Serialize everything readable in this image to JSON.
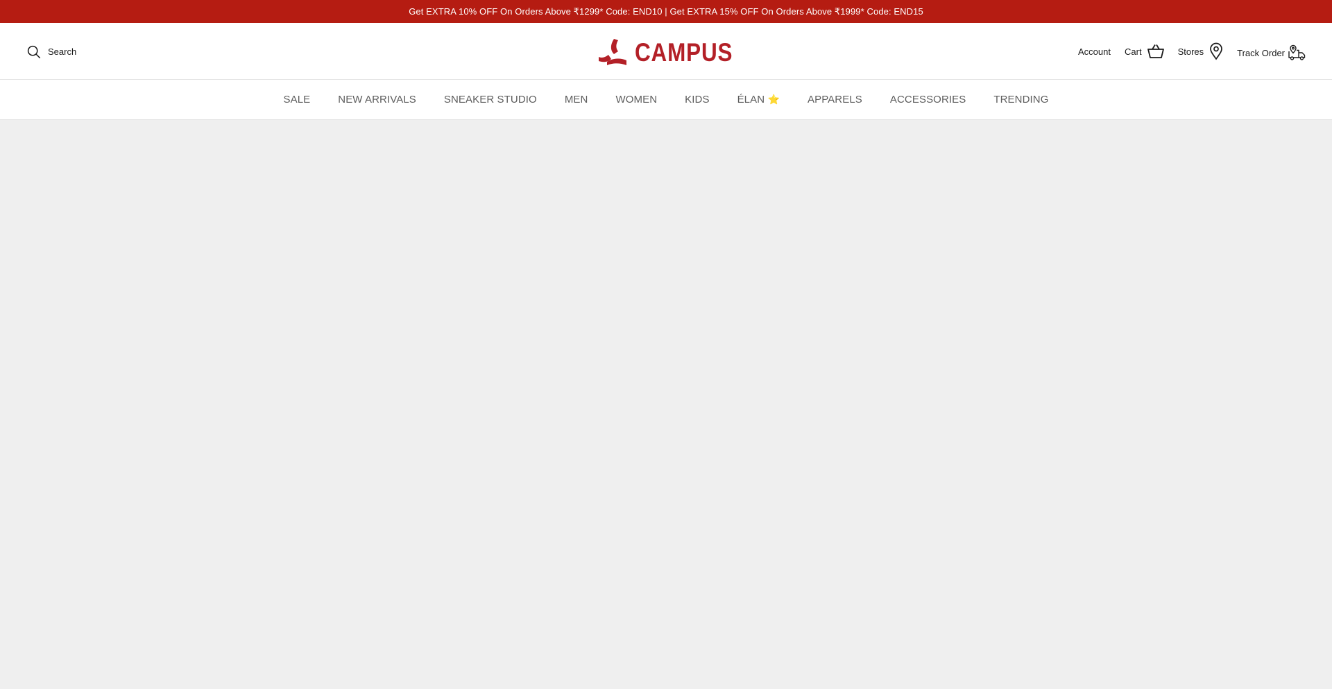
{
  "announcement": {
    "text": "Get EXTRA 10% OFF On Orders Above ₹1299* Code: END10 | Get EXTRA 15% OFF On Orders Above ₹1999* Code: END15"
  },
  "header": {
    "search_label": "Search",
    "logo_text": "CAMPUS",
    "account_label": "Account",
    "cart_label": "Cart",
    "stores_label": "Stores",
    "track_order_label": "Track Order"
  },
  "nav": {
    "items": [
      {
        "label": "SALE"
      },
      {
        "label": "NEW ARRIVALS"
      },
      {
        "label": "SNEAKER STUDIO"
      },
      {
        "label": "MEN"
      },
      {
        "label": "WOMEN"
      },
      {
        "label": "KIDS"
      },
      {
        "label": "ÉLAN",
        "suffix": "⭐"
      },
      {
        "label": "APPARELS"
      },
      {
        "label": "ACCESSORIES"
      },
      {
        "label": "TRENDING"
      }
    ]
  },
  "colors": {
    "announcement_bg": "#b51c12",
    "brand_red": "#b32027",
    "nav_text": "#5c5c5c",
    "content_bg": "#efefef"
  },
  "icons": {
    "search": "search-icon",
    "logo": "campus-logo-icon",
    "cart": "basket-icon",
    "stores": "location-pin-icon",
    "track": "delivery-truck-icon"
  }
}
